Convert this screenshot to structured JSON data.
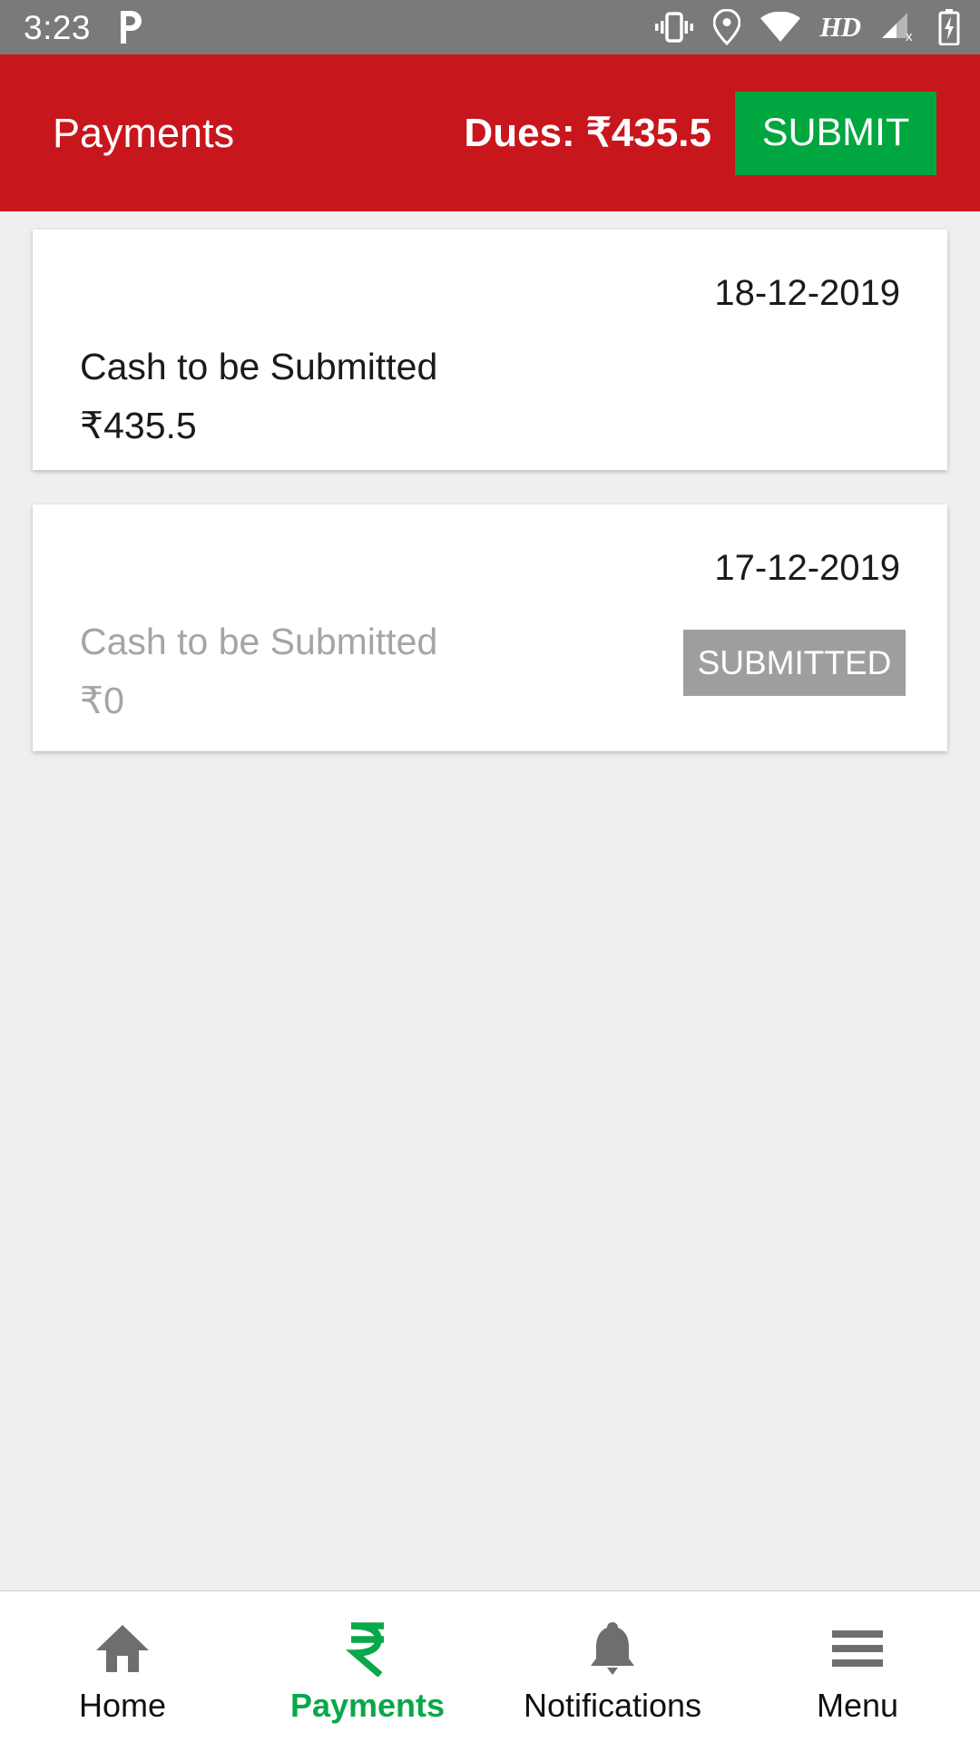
{
  "status_bar": {
    "time": "3:23",
    "left_icons": [
      "paytm-p-icon"
    ],
    "right_icons": [
      "vibrate-icon",
      "location-pin-icon",
      "wifi-icon",
      "signal-off-icon",
      "battery-charging-icon"
    ],
    "hd_label": "HD"
  },
  "app_bar": {
    "title": "Payments",
    "dues_label": "Dues:",
    "dues_amount": "₹435.5",
    "dues_full": "Dues:  ₹435.5",
    "submit_label": "SUBMIT",
    "background_color": "#C8161D",
    "submit_color": "#00A63F"
  },
  "cards": [
    {
      "date": "18-12-2019",
      "label": "Cash to be Submitted",
      "amount": "₹435.5",
      "state": "pending",
      "has_button": false
    },
    {
      "date": "17-12-2019",
      "label": "Cash to be Submitted",
      "amount": "₹0",
      "state": "submitted",
      "has_button": true,
      "button_label": "SUBMITTED",
      "button_color": "#9E9E9E"
    }
  ],
  "bottom_nav": {
    "active_color": "#09A84A",
    "items": [
      {
        "label": "Home",
        "icon": "home-icon",
        "active": false
      },
      {
        "label": "Payments",
        "icon": "rupee-icon",
        "active": true
      },
      {
        "label": "Notifications",
        "icon": "bell-icon",
        "active": false
      },
      {
        "label": "Menu",
        "icon": "hamburger-menu-icon",
        "active": false
      }
    ]
  }
}
